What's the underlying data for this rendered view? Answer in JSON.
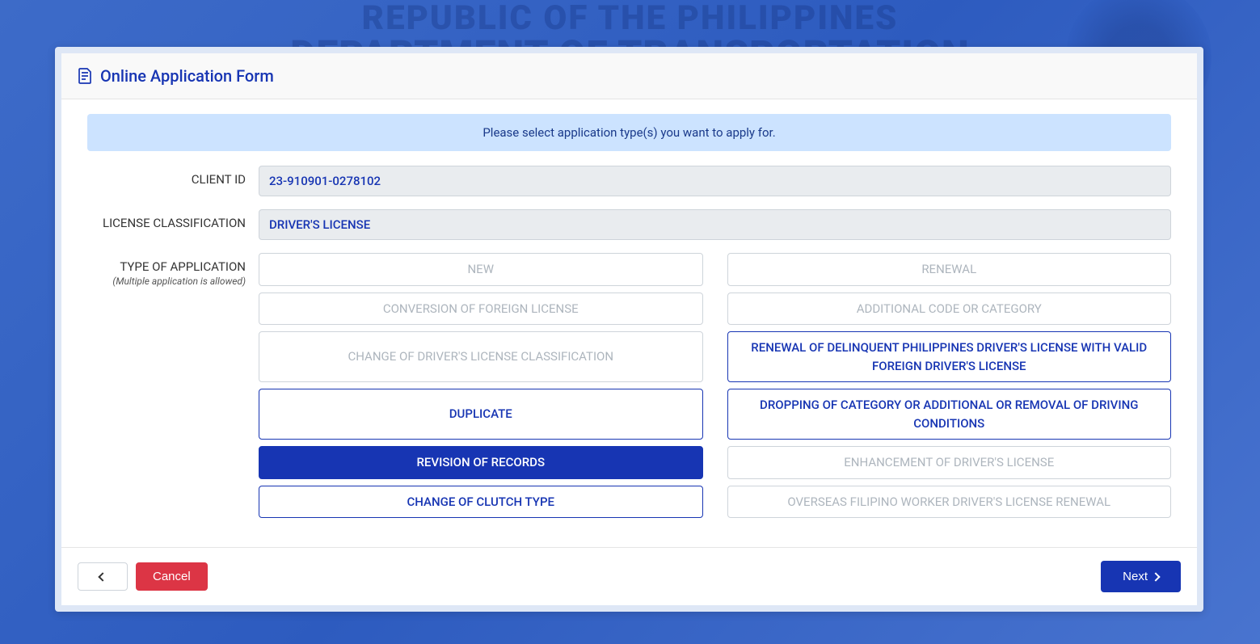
{
  "background": {
    "line1": "REPUBLIC OF THE PHILIPPINES",
    "line2": "DEPARTMENT OF TRANSPORTATION"
  },
  "header": {
    "title": "Online Application Form"
  },
  "alert": {
    "message": "Please select application type(s) you want to apply for."
  },
  "form": {
    "client_id_label": "CLIENT ID",
    "client_id_value": "23-910901-0278102",
    "license_class_label": "LICENSE CLASSIFICATION",
    "license_class_value": "DRIVER'S LICENSE",
    "type_label": "TYPE OF APPLICATION",
    "type_sublabel": "(Multiple application is allowed)"
  },
  "options": [
    {
      "label": "NEW",
      "state": "disabled"
    },
    {
      "label": "RENEWAL",
      "state": "disabled"
    },
    {
      "label": "CONVERSION OF FOREIGN LICENSE",
      "state": "disabled"
    },
    {
      "label": "ADDITIONAL CODE OR CATEGORY",
      "state": "disabled"
    },
    {
      "label": "CHANGE OF DRIVER'S LICENSE CLASSIFICATION",
      "state": "disabled"
    },
    {
      "label": "RENEWAL OF DELINQUENT PHILIPPINES DRIVER'S LICENSE WITH VALID FOREIGN DRIVER'S LICENSE",
      "state": "available"
    },
    {
      "label": "DUPLICATE",
      "state": "available"
    },
    {
      "label": "DROPPING OF CATEGORY OR ADDITIONAL OR REMOVAL OF DRIVING CONDITIONS",
      "state": "available"
    },
    {
      "label": "REVISION OF RECORDS",
      "state": "selected"
    },
    {
      "label": "ENHANCEMENT OF DRIVER'S LICENSE",
      "state": "disabled"
    },
    {
      "label": "CHANGE OF CLUTCH TYPE",
      "state": "available"
    },
    {
      "label": "OVERSEAS FILIPINO WORKER DRIVER'S LICENSE RENEWAL",
      "state": "disabled"
    }
  ],
  "footer": {
    "cancel_label": "Cancel",
    "next_label": "Next"
  }
}
